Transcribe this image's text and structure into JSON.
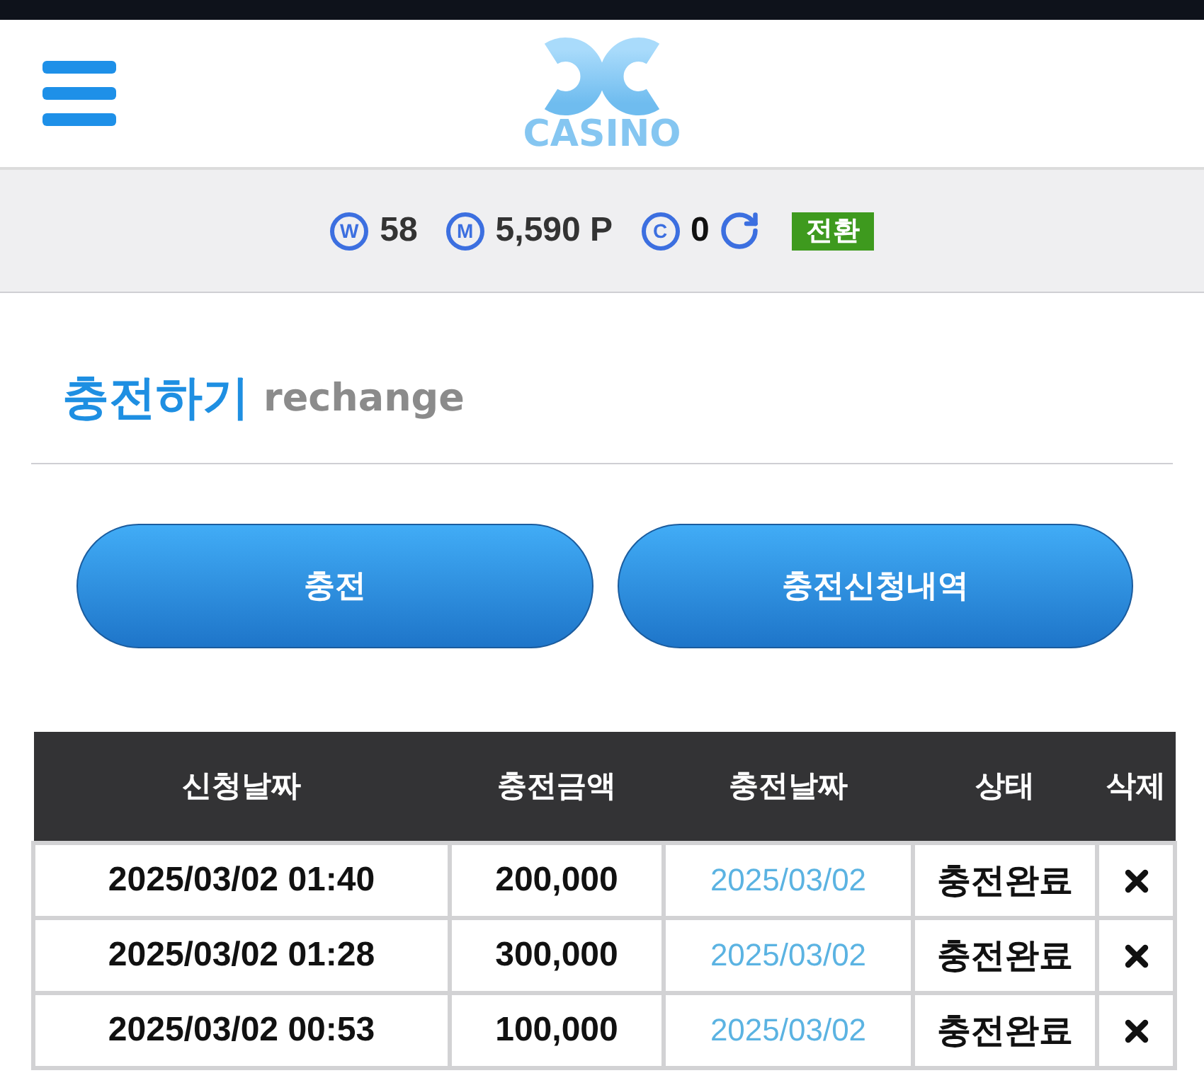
{
  "header": {
    "logo_text": "CASINO"
  },
  "balances": [
    {
      "symbol": "W",
      "value": "58"
    },
    {
      "symbol": "M",
      "value": "5,590 P"
    },
    {
      "symbol": "C",
      "value": "0"
    }
  ],
  "convert_button": "전환",
  "title": {
    "main": "충전하기",
    "sub": "rechange"
  },
  "buttons": [
    "충전",
    "충전신청내역"
  ],
  "table": {
    "columns": [
      "신청날짜",
      "충전금액",
      "충전날짜",
      "상태",
      "삭제"
    ],
    "rows": [
      {
        "requested": "2025/03/02 01:40",
        "amount": "200,000",
        "charged": "2025/03/02",
        "status": "충전완료"
      },
      {
        "requested": "2025/03/02 01:28",
        "amount": "300,000",
        "charged": "2025/03/02",
        "status": "충전완료"
      },
      {
        "requested": "2025/03/02 00:53",
        "amount": "100,000",
        "charged": "2025/03/02",
        "status": "충전완료"
      }
    ]
  }
}
